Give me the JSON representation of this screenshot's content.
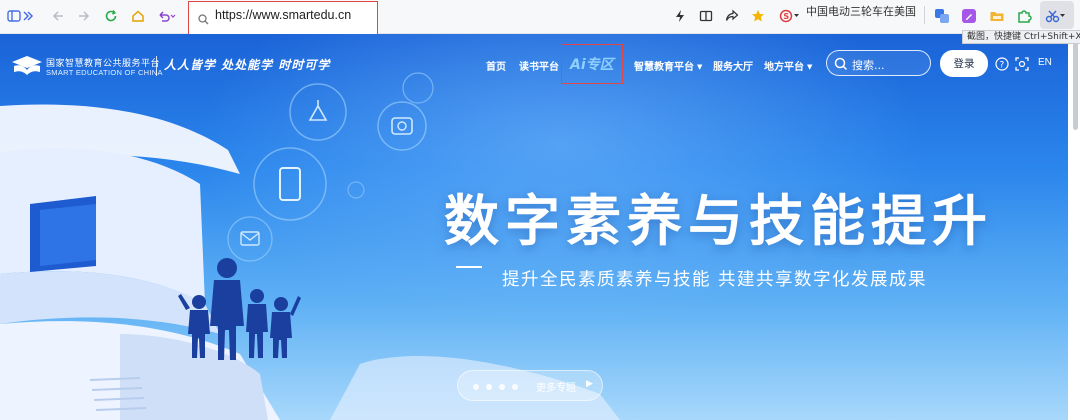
{
  "browser": {
    "url": "https://www.smartedu.cn",
    "news_ticker": "中国电动三轮车在美国",
    "tooltip": "截图，快捷键 Ctrl+Shift+X",
    "icons": [
      "sidebar-icon",
      "back-icon",
      "forward-icon",
      "reload-icon",
      "home-icon",
      "undo-icon",
      "search-icon",
      "lightning-icon",
      "reader-icon",
      "share-icon",
      "star-icon",
      "sogou-icon",
      "translate-icon",
      "edit-icon",
      "folder-icon",
      "puzzle-icon",
      "scissors-icon"
    ],
    "colors": {
      "toolbar_bg": "#f7f8fa",
      "highlight_box": "#e04848"
    }
  },
  "site": {
    "logo": {
      "name_cn": "国家智慧教育公共服务平台",
      "name_en": "SMART EDUCATION OF CHINA"
    },
    "slogan": "人人皆学 处处能学 时时可学",
    "nav": {
      "home": "首页",
      "reading": "读书平台",
      "ai_zone": "Ai专区",
      "smart_edu": "智慧教育平台",
      "service": "服务大厅",
      "local": "地方平台"
    },
    "search": {
      "placeholder": "搜索..."
    },
    "login_label": "登录",
    "lang_label": "EN",
    "hero": {
      "title": "数字素养与技能提升",
      "subtitle": "提升全民素质素养与技能  共建共享数字化发展成果"
    },
    "carousel": {
      "more_label": "更多专题",
      "slide_count": 4,
      "active_index": 1
    },
    "colors": {
      "hero_top": "#1a63d8",
      "hero_bottom": "#a8d8fb",
      "ai_accent": "#8fd0ff"
    }
  }
}
